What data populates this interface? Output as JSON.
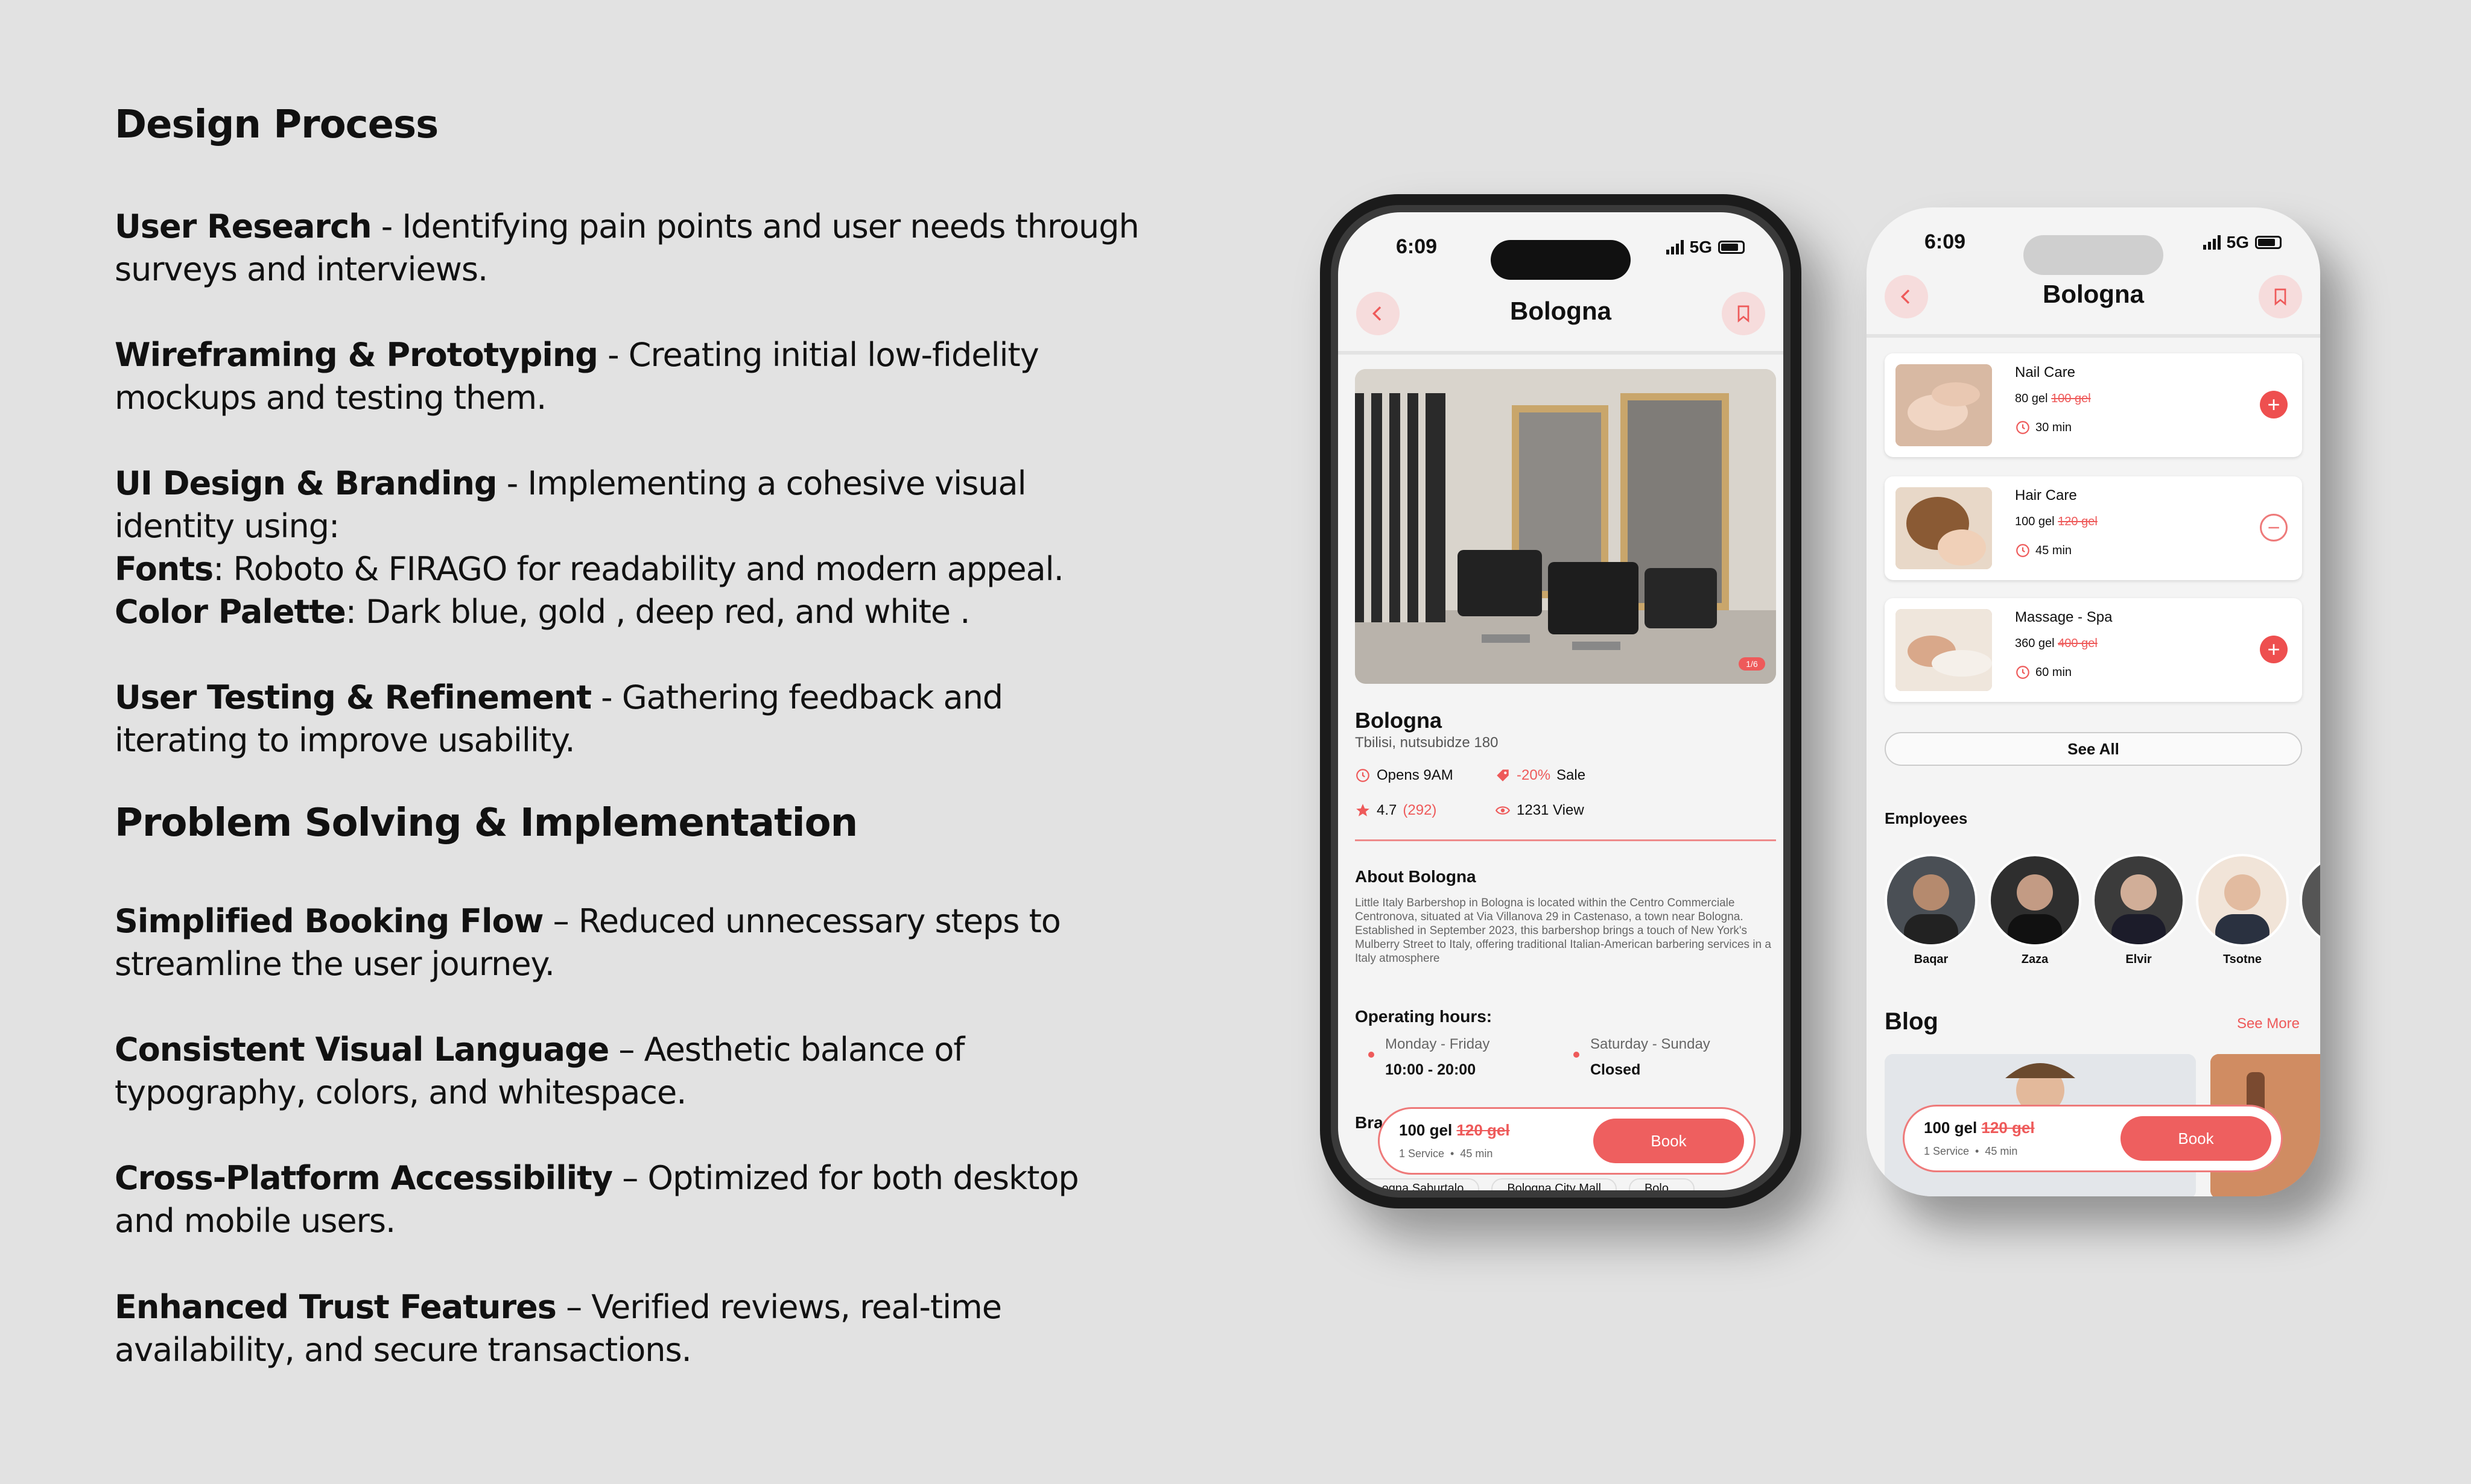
{
  "left": {
    "design_process_title": "Design Process",
    "user_research": {
      "title": "User Research",
      "text": " - Identifying pain points and user needs through surveys and interviews."
    },
    "wireframing": {
      "title": "Wireframing & Prototyping",
      "text": " - Creating initial low-fidelity mockups and testing them."
    },
    "ui_design": {
      "title": "UI Design & Branding",
      "text": " -  Implementing a cohesive visual identity using:"
    },
    "fonts": {
      "title": "Fonts",
      "text": ": Roboto & FIRAGO for readability and modern appeal."
    },
    "palette": {
      "title": "Color Palette",
      "text": ": Dark blue, gold , deep red, and white ."
    },
    "user_testing": {
      "title": "User Testing & Refinement",
      "text": " -  Gathering feedback and iterating to improve usability."
    },
    "problem_solving_title": "Problem Solving & Implementation",
    "simplified": {
      "title": "Simplified Booking Flow",
      "text": " – Reduced unnecessary steps to streamline the user journey."
    },
    "consistent": {
      "title": "Consistent Visual Language",
      "text": " – Aesthetic balance of typography, colors, and whitespace."
    },
    "cross": {
      "title": "Cross-Platform Accessibility",
      "text": " – Optimized for both desktop and mobile users."
    },
    "trust": {
      "title": "Enhanced Trust Features",
      "text": " – Verified reviews, real-time availability, and secure transactions."
    }
  },
  "status": {
    "time": "6:09",
    "network": "5G"
  },
  "phone1": {
    "title": "Bologna",
    "name": "Bologna",
    "address": "Tbilisi, nutsubidze 180",
    "opens": "Opens 9AM",
    "sale_pct": "-20%",
    "sale_label": "Sale",
    "rating": "4.7",
    "reviews": "(292)",
    "views": "1231 View",
    "about_title": "About Bologna",
    "about_text": "Little Italy Barbershop in Bologna is located within the Centro Commerciale Centronova, situated at Via Villanova 29 in Castenaso, a town near Bologna. Established in September 2023, this barbershop brings a touch of New York's Mulberry Street to Italy, offering traditional Italian-American barbering services in a Italy atmosphere",
    "hours_title": "Operating hours:",
    "weekdays": "Monday - Friday",
    "weekday_hours": "10:00 - 20:00",
    "weekend": "Saturday - Sunday",
    "weekend_hours": "Closed",
    "branches_title": "Bra",
    "branches": [
      "...ogna Saburtalo",
      "Bologna City Mall",
      "Bolo..."
    ],
    "image_counter": "1/6"
  },
  "booking": {
    "price": "100 gel",
    "old_price": "120 gel",
    "meta_service": "1 Service",
    "meta_dur": "45 min",
    "book_label": "Book"
  },
  "phone2": {
    "title": "Bologna",
    "services": [
      {
        "name": "Nail Care",
        "price": "80 gel",
        "old": "100 gel",
        "dur": "30 min",
        "action": "add"
      },
      {
        "name": "Hair Care",
        "price": "100 gel",
        "old": "120 gel",
        "dur": "45 min",
        "action": "remove"
      },
      {
        "name": "Massage - Spa",
        "price": "360 gel",
        "old": "400 gel",
        "dur": "60 min",
        "action": "add"
      }
    ],
    "see_all": "See All",
    "employees_title": "Employees",
    "employees": [
      "Baqar",
      "Zaza",
      "Elvir",
      "Tsotne"
    ],
    "blog_title": "Blog",
    "see_more": "See More"
  },
  "colors": {
    "accent": "#ee5a5a",
    "background": "#e2e2e2"
  }
}
